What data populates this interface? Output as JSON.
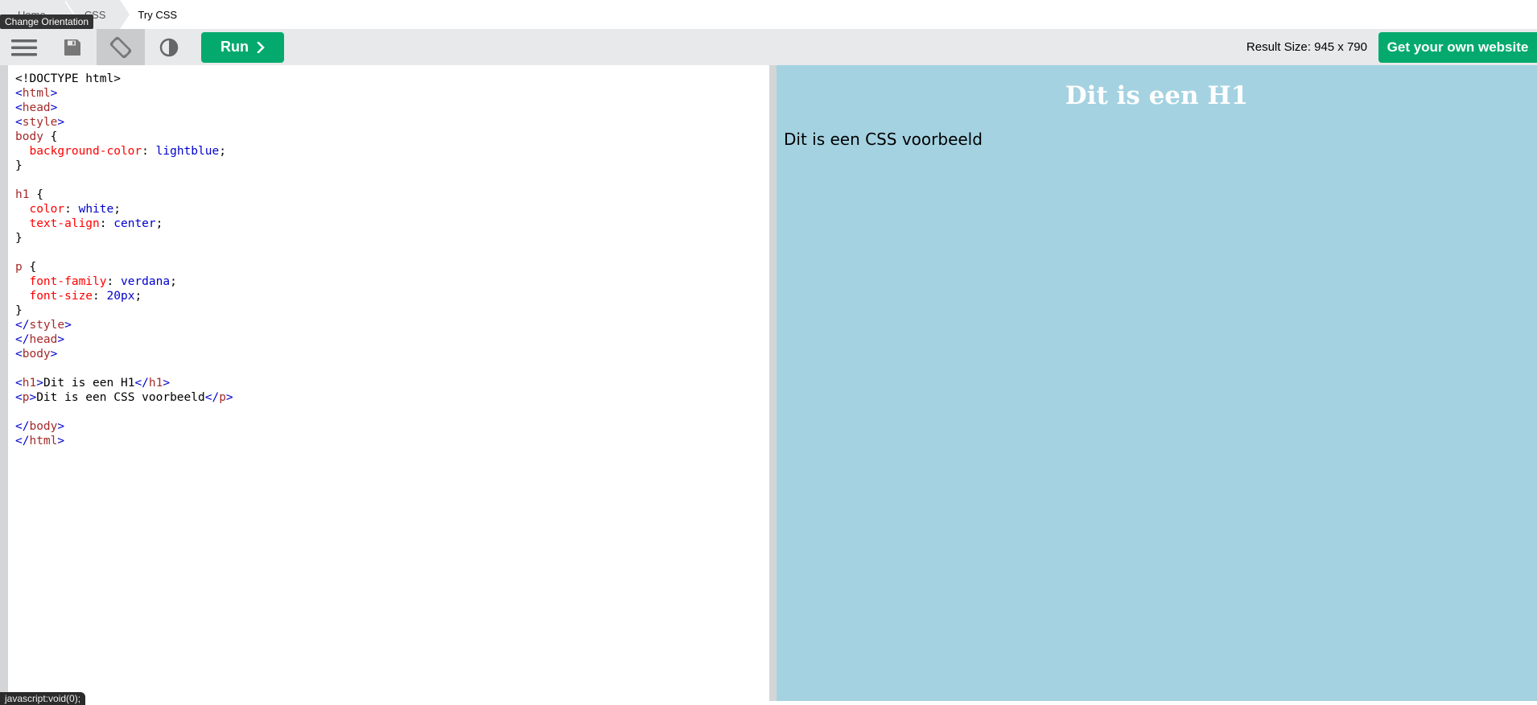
{
  "breadcrumb": {
    "home": "Home",
    "css": "CSS",
    "current": "Try CSS",
    "tooltip": "Change Orientation"
  },
  "toolbar": {
    "menu_icon": "hamburger-menu-icon",
    "save_icon": "floppy-disk-icon",
    "orientation_icon": "rotate-phone-icon",
    "theme_icon": "half-circle-contrast-icon",
    "run_label": "Run",
    "result_size": "Result Size: 945 x 790",
    "own_site_label": "Get your own website"
  },
  "editor": {
    "lines": [
      "<!DOCTYPE html>",
      "<html>",
      "<head>",
      "<style>",
      "body {",
      "  background-color: lightblue;",
      "}",
      "",
      "h1 {",
      "  color: white;",
      "  text-align: center;",
      "}",
      "",
      "p {",
      "  font-family: verdana;",
      "  font-size: 20px;",
      "}",
      "</style>",
      "</head>",
      "<body>",
      "",
      "<h1>Dit is een H1</h1>",
      "<p>Dit is een CSS voorbeeld</p>",
      "",
      "</body>",
      "</html>"
    ]
  },
  "result": {
    "h1": "Dit is een H1",
    "p": "Dit is een CSS voorbeeld",
    "background": "#a4d2e1"
  },
  "status": {
    "text": "javascript:void(0);"
  },
  "colors": {
    "accent": "#04aa6d",
    "toolbar_bg": "#e7e9eb"
  }
}
